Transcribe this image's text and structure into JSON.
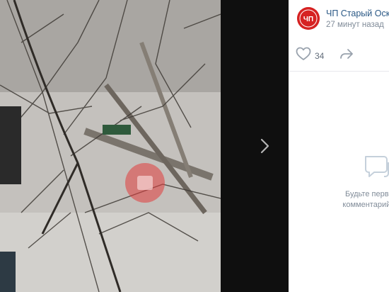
{
  "post": {
    "group_name": "ЧП Старый Оскол",
    "time": "27 минут назад",
    "avatar_text": "ЧП",
    "likes": "34"
  },
  "comments": {
    "empty_line1": "Будьте первым, к",
    "empty_line2": "комментарий к это"
  },
  "icons": {
    "like": "heart-icon",
    "share": "share-arrow-icon",
    "next": "chevron-right-icon",
    "comment": "comment-bubble-icon"
  },
  "colors": {
    "accent": "#2a5885",
    "muted": "#818c99",
    "avatar_bg": "#d62222"
  }
}
